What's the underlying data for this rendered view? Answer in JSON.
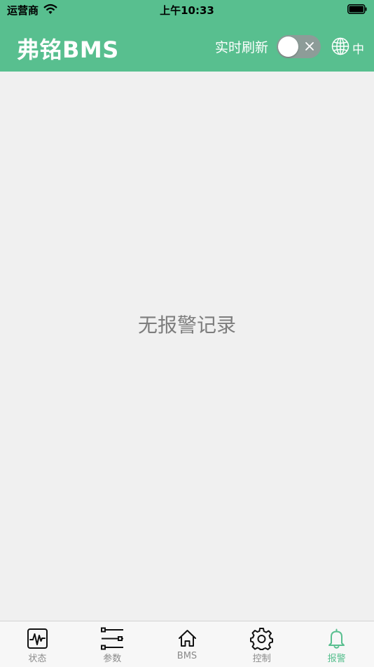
{
  "status_bar": {
    "carrier": "运营商",
    "time": "上午10:33"
  },
  "header": {
    "title": "弗铭BMS",
    "refresh_label": "实时刷新",
    "refresh_enabled": false,
    "language_label": "中"
  },
  "main": {
    "empty_message": "无报警记录"
  },
  "tabs": [
    {
      "label": "状态",
      "icon": "monitor-icon",
      "active": false
    },
    {
      "label": "参数",
      "icon": "sliders-icon",
      "active": false
    },
    {
      "label": "BMS",
      "icon": "home-icon",
      "active": false
    },
    {
      "label": "控制",
      "icon": "gear-icon",
      "active": false
    },
    {
      "label": "报警",
      "icon": "bell-icon",
      "active": true
    }
  ],
  "colors": {
    "accent": "#58bf8f",
    "background": "#f0f0f0",
    "toggle_off": "#8d9c98"
  }
}
